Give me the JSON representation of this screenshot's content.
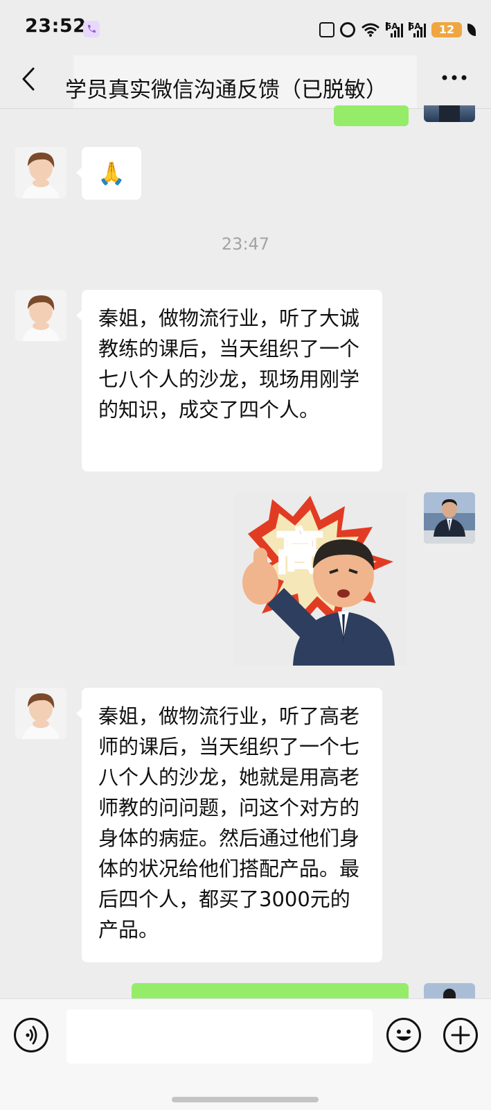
{
  "status_bar": {
    "time": "23:52",
    "network_1": "5A",
    "network_2": "5A",
    "battery": "12"
  },
  "nav": {
    "title": "学员真实微信沟通反馈（已脱敏）"
  },
  "messages": [
    {
      "side": "left",
      "type": "emoji",
      "content": "🙏"
    },
    {
      "type": "time",
      "content": "23:47"
    },
    {
      "side": "left",
      "type": "text",
      "content": "秦姐，做物流行业，听了大诚教练的课后，当天组织了一个七八个人的沙龙，现场用刚学的知识，成交了四个人。"
    },
    {
      "side": "right",
      "type": "sticker",
      "content": "高"
    },
    {
      "side": "left",
      "type": "text",
      "content": "秦姐，做物流行业，听了高老师的课后，当天组织了一个七八个人的沙龙，她就是用高老师教的问问题，问这个对方的身体的病症。然后通过他们身体的状况给他们搭配产品。最后四个人，都买了3000元的产品。"
    }
  ],
  "colors": {
    "background": "#ededed",
    "sent_bubble": "#95ec69",
    "received_bubble": "#ffffff",
    "time_text": "#a3a3a3"
  }
}
